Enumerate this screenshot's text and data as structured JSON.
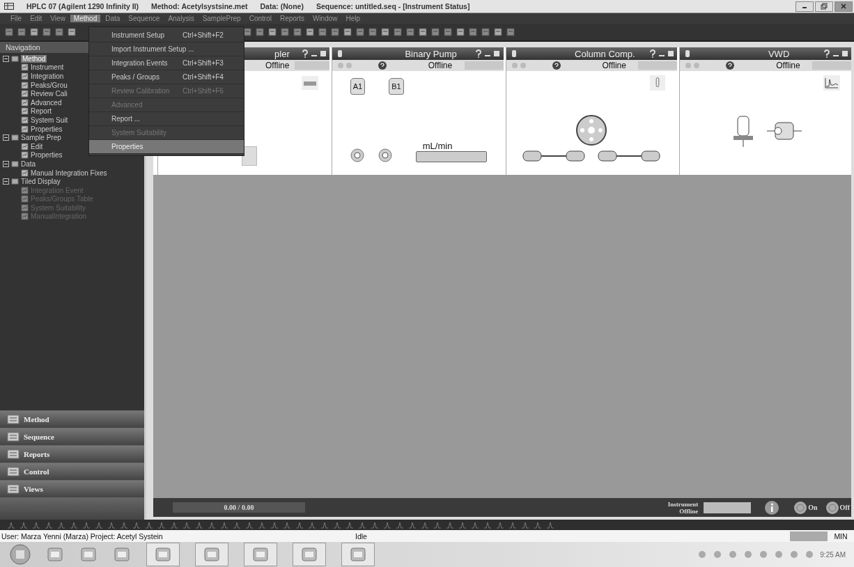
{
  "window": {
    "title_parts": [
      "HPLC 07 (Agilent 1290 Infinity II)",
      "Method: Acetylsystsine.met",
      "Data: (None)",
      "Sequence: untitled.seq - [Instrument Status]"
    ]
  },
  "menu": [
    {
      "label": "File",
      "selected": false
    },
    {
      "label": "Edit",
      "selected": false
    },
    {
      "label": "View",
      "selected": false
    },
    {
      "label": "Method",
      "selected": true
    },
    {
      "label": "Data",
      "selected": false
    },
    {
      "label": "Sequence",
      "selected": false
    },
    {
      "label": "Analysis",
      "selected": false
    },
    {
      "label": "SamplePrep",
      "selected": false
    },
    {
      "label": "Control",
      "selected": false
    },
    {
      "label": "Reports",
      "selected": false
    },
    {
      "label": "Window",
      "selected": false
    },
    {
      "label": "Help",
      "selected": false
    }
  ],
  "dropdown": [
    {
      "label": "Instrument Setup",
      "shortcut": "Ctrl+Shift+F2",
      "disabled": false,
      "selected": false
    },
    {
      "label": "Import Instrument Setup ...",
      "disabled": false,
      "selected": false
    },
    {
      "label": "Integration Events",
      "shortcut": "Ctrl+Shift+F3",
      "disabled": false,
      "selected": false
    },
    {
      "label": "Peaks / Groups",
      "shortcut": "Ctrl+Shift+F4",
      "disabled": false,
      "selected": false
    },
    {
      "label": "Review Calibration",
      "shortcut": "Ctrl+Shift+F6",
      "disabled": true,
      "selected": false
    },
    {
      "label": "Advanced",
      "disabled": true,
      "selected": false
    },
    {
      "label": "Report ...",
      "disabled": false,
      "selected": false
    },
    {
      "label": "System Suitability",
      "disabled": true,
      "selected": false
    },
    {
      "label": "Properties",
      "disabled": false,
      "selected": true
    }
  ],
  "navigation": {
    "title": "Navigation",
    "tree": [
      {
        "label": "Method",
        "selected": true,
        "expanded": true,
        "children": [
          {
            "label": "Instrument",
            "disabled": false
          },
          {
            "label": "Integration",
            "disabled": false
          },
          {
            "label": "Peaks/Grou",
            "disabled": false
          },
          {
            "label": "Review Cali",
            "disabled": false
          },
          {
            "label": "Advanced",
            "disabled": false
          },
          {
            "label": "Report",
            "disabled": false
          },
          {
            "label": "System Suit",
            "disabled": false
          },
          {
            "label": "Properties",
            "disabled": false
          }
        ]
      },
      {
        "label": "Sample Prep",
        "selected": false,
        "expanded": true,
        "children": [
          {
            "label": "Edit",
            "disabled": false
          },
          {
            "label": "Properties",
            "disabled": false
          }
        ]
      },
      {
        "label": "Data",
        "selected": false,
        "expanded": true,
        "children": [
          {
            "label": "Manual Integration Fixes",
            "disabled": false
          }
        ]
      },
      {
        "label": "Tiled Display",
        "selected": false,
        "expanded": true,
        "children": [
          {
            "label": "Integration Event",
            "disabled": true
          },
          {
            "label": "Peaks/Groups Table",
            "disabled": true
          },
          {
            "label": "System Suitability",
            "disabled": true
          },
          {
            "label": "ManualIntegration",
            "disabled": true
          }
        ]
      }
    ],
    "sections": [
      "Method",
      "Sequence",
      "Reports",
      "Control",
      "Views"
    ]
  },
  "modules": [
    {
      "kind": "sampler",
      "title": "pler",
      "status": "Offline"
    },
    {
      "kind": "pump",
      "title": "Binary Pump",
      "status": "Offline",
      "bottles": [
        "A1",
        "B1"
      ],
      "flow_unit": "mL/min"
    },
    {
      "kind": "column",
      "title": "Column Comp.",
      "status": "Offline"
    },
    {
      "kind": "detector",
      "title": "VWD",
      "status": "Offline"
    }
  ],
  "run_bar": {
    "progress": "0.00 / 0.00",
    "instrument_status": [
      "Instrument",
      "Offline"
    ],
    "on": "On",
    "off": "Off"
  },
  "status_bar": {
    "user": "User: Marza Yenni (Marza)  Project: Acetyl Systein",
    "state": "Idle",
    "mode": "MIN"
  },
  "taskbar": {
    "time": "9:25 AM"
  }
}
